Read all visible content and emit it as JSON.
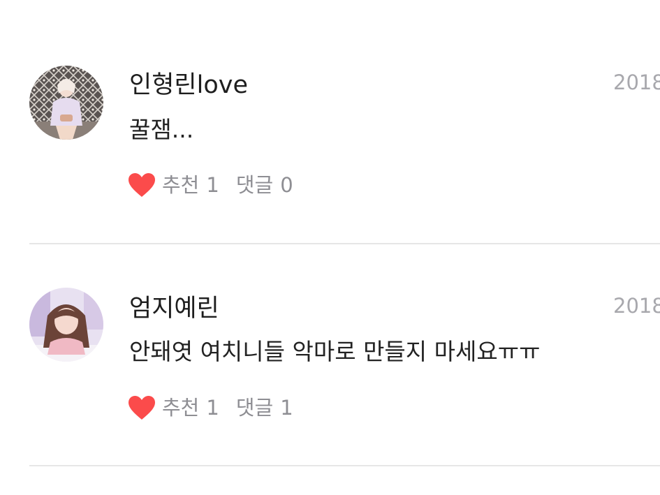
{
  "comments": [
    {
      "username": "인형린love",
      "date": "2018",
      "text": "꿀잼...",
      "like_label": "추천",
      "like_count": "1",
      "reply_label": "댓글",
      "reply_count": "0",
      "avatar_icon": "user-avatar-photo"
    },
    {
      "username": "엄지예린",
      "date": "2018",
      "text": "안돼엿 여치니들 악마로 만들지 마세요ㅠㅠ",
      "like_label": "추천",
      "like_count": "1",
      "reply_label": "댓글",
      "reply_count": "1",
      "avatar_icon": "user-avatar-photo"
    }
  ],
  "colors": {
    "heart": "#fb4b4b",
    "meta_text": "#8e8e93",
    "date_text": "#a8a8ad",
    "divider": "#e6e6e6"
  },
  "icons": {
    "like": "heart-icon"
  }
}
